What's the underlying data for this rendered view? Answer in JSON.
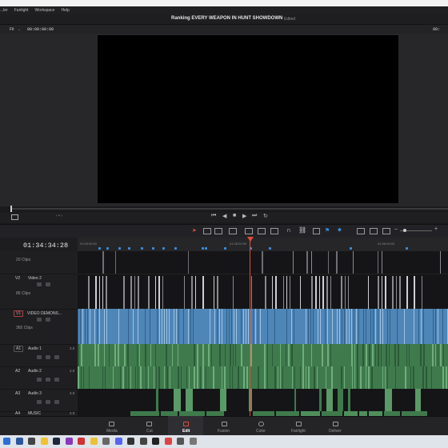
{
  "menu": [
    "...ler",
    "Fairlight",
    "Workspace",
    "Help"
  ],
  "project": {
    "title": "Ranking EVERY WEAPON IN HUNT SHOWDOWN",
    "status": "Edited"
  },
  "viewer": {
    "zoom": "Fit",
    "timecode": "00:00:00:00",
    "right_timecode": "00:"
  },
  "timeline": {
    "timecode": "01:34:34:28",
    "ruler": [
      "01:00:00:00",
      "01:28:02:00",
      "01:56:04:00"
    ],
    "tracks": [
      {
        "id": "",
        "name": "",
        "clips": "20 Clips",
        "kind": "video-top"
      },
      {
        "id": "V2",
        "name": "Video 2",
        "clips": "86 Clips",
        "kind": "video"
      },
      {
        "id": "V1",
        "name": "VIDEO DEMONS...",
        "clips": "365 Clips",
        "kind": "video-main"
      },
      {
        "id": "A1",
        "name": "Audio 1",
        "channel": "2.0",
        "kind": "audio"
      },
      {
        "id": "A2",
        "name": "Audio 2",
        "channel": "2.0",
        "kind": "audio"
      },
      {
        "id": "A3",
        "name": "Audio 3",
        "channel": "2.0",
        "kind": "audio"
      },
      {
        "id": "A4",
        "name": "MUSIC",
        "channel": "2.0",
        "kind": "audio"
      }
    ]
  },
  "pages": [
    {
      "label": "Media",
      "active": false
    },
    {
      "label": "Cut",
      "active": false
    },
    {
      "label": "Edit",
      "active": true
    },
    {
      "label": "Fusion",
      "active": false
    },
    {
      "label": "Color",
      "active": false
    },
    {
      "label": "Fairlight",
      "active": false
    },
    {
      "label": "Deliver",
      "active": false
    }
  ],
  "colors": {
    "accent": "#e24c3a",
    "video_clip": "#4f86b8",
    "audio_clip": "#3f7a4d",
    "marker": "#3c8fe0"
  },
  "taskbar_icons": [
    "windows-icon",
    "word-icon",
    "app-icon",
    "explorer-icon",
    "steam-icon",
    "app-icon",
    "close-app-icon",
    "chrome-icon",
    "app-icon",
    "discord-icon",
    "resolve-icon",
    "app-icon",
    "app-icon",
    "app-icon",
    "app-icon",
    "app-icon"
  ]
}
